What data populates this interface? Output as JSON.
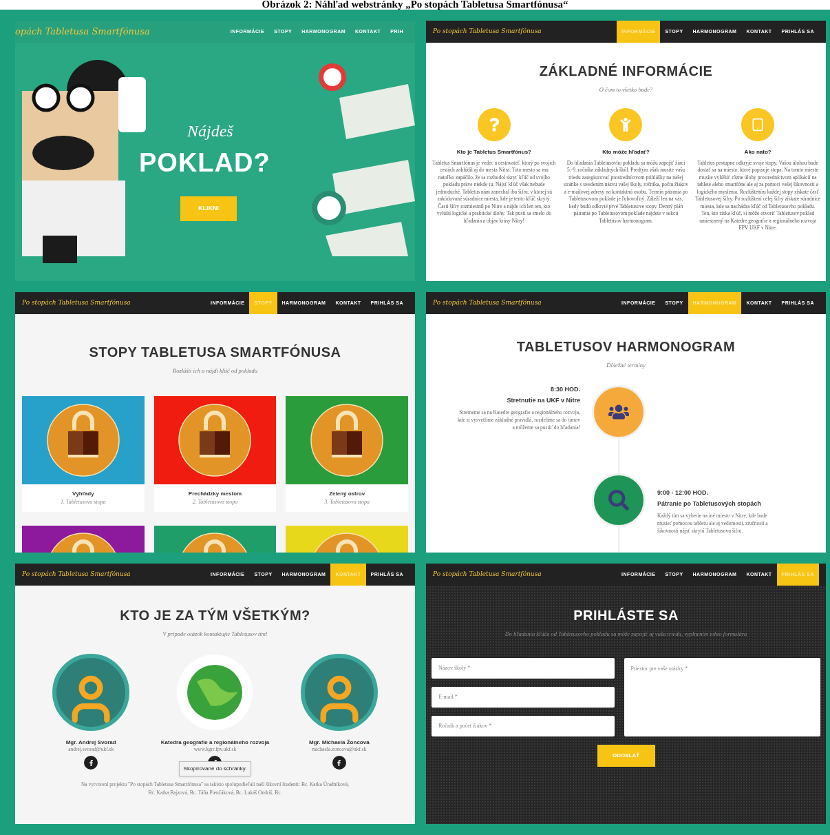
{
  "caption": "Obrázok 2: Náhľad webstránky „Po stopách Tabletusa Smartfónusa“",
  "panels": [
    {
      "kind": "hero",
      "brand": "opách Tabletusa Smartfónusa",
      "nav": [
        {
          "label": "INFORMÁCIE",
          "selected": false
        },
        {
          "label": "STOPY",
          "selected": false
        },
        {
          "label": "HARMONOGRAM",
          "selected": false
        },
        {
          "label": "KONTAKT",
          "selected": false
        },
        {
          "label": "PRIH",
          "selected": false
        }
      ],
      "tagline": "Nájdeš",
      "headline": "POKLAD?",
      "button": "KLIKNI"
    },
    {
      "kind": "info",
      "brand": "Po stopách Tabletusa Smartfónusa",
      "nav": [
        {
          "label": "INFORMÁCIE",
          "selected": true
        },
        {
          "label": "STOPY",
          "selected": false
        },
        {
          "label": "HARMONOGRAM",
          "selected": false
        },
        {
          "label": "KONTAKT",
          "selected": false
        },
        {
          "label": "PRIHLÁS SA",
          "selected": false
        }
      ],
      "title": "ZÁKLADNÉ INFORMÁCIE",
      "subtitle": "O čom to všetko bude?",
      "features": [
        {
          "kind": "question",
          "title": "Kto je Tabletus Smartfónus?",
          "text": "Tabletus Smartfónus je vedec a cestovateľ, ktorý po svojich cestách zablúdil aj do mesta Nitra. Toto mesto sa mu natoľko zapáčilo, že sa rozhodol skryť kľúč od svojho pokladu práve niekde tu. Nájsť kľúč však nebude jednoduché. Tabletus nám zanechal iba šifru, v ktorej sú zakódované súradnice miesta, kde je tento kľúč skrytý. Časti šifry rozmiestnil po Nitre a nájde ich len ten, kto vylúšti logické a praktické úlohy. Tak pusti sa smelo do hľadania a objav krásy Nitry!"
        },
        {
          "kind": "child",
          "title": "Kto môže hľadať?",
          "text": "Do hľadania Tabletusovho pokladu sa môžu zapojiť žiaci 5.-9. ročníka základných škôl. Predtým však musíte vašu triedu zaregistrovať prostredníctvom prihlášky na našej stránke s uvedením názvu vašej školy, ročníka, počtu žiakov a e-mailovej adresy na kontaktnú osobu. Termín pátrania po Tabletusovom poklade je ľubovoľný. Záleží len na vás, kedy budú odkryté prvé Tabletusove stopy. Denný plán pátrania po Tabletusovom poklade nájdete v sekcii Tabletusov harmonogram."
        },
        {
          "kind": "tablet",
          "title": "Ako nato?",
          "text": "Tabletus postupne odkryje svoje stopy. Vašou úlohou bude dostať sa na miesto, ktoré popisuje stopa. Na tomto mieste musíte vylúštiť rôzne úlohy prostredníctvom aplikácií na tablete alebo smartfóne ale aj za pomoci vašej šikovnosti a logického myslenia. Rozlúštením každej stopy získate časť Tabletusovej šifry. Po rozlúštení celej šifry získate súradnice miesta, kde sa nachádza kľúč od Tabletusovho pokladu. Ten, kto získa kľúč, si môže otvoriť Tabletusov poklad umiestnený na Katedre geografie a regionálneho rozvoja FPV UKF v Nitre."
        }
      ]
    },
    {
      "kind": "tracks",
      "brand": "Po stopách Tabletusa Smartfónusa",
      "nav": [
        {
          "label": "INFORMÁCIE",
          "selected": false
        },
        {
          "label": "STOPY",
          "selected": true
        },
        {
          "label": "HARMONOGRAM",
          "selected": false
        },
        {
          "label": "KONTAKT",
          "selected": false
        },
        {
          "label": "PRIHLÁS SA",
          "selected": false
        }
      ],
      "title": "STOPY TABLETUSA SMARTFÓNUSA",
      "subtitle": "Rozlúšti ich a nájdi kľúč od pokladu",
      "cards": [
        {
          "title": "Výhľady",
          "subtitle": "1. Tabletusova stopa",
          "color": "#27a1c9"
        },
        {
          "title": "Prechádzky mestom",
          "subtitle": "2. Tabletusova stopa",
          "color": "#f01c10"
        },
        {
          "title": "Zelený ostrov",
          "subtitle": "3. Tabletusova stopa",
          "color": "#2b9c3b"
        },
        {
          "color": "#8d1a9c"
        },
        {
          "color": "#1f9e6a"
        },
        {
          "color": "#e8d81c"
        }
      ]
    },
    {
      "kind": "schedule",
      "brand": "Po stopách Tabletusa Smartfónusa",
      "nav": [
        {
          "label": "INFORMÁCIE",
          "selected": false
        },
        {
          "label": "STOPY",
          "selected": false
        },
        {
          "label": "HARMONOGRAM",
          "selected": true
        },
        {
          "label": "KONTAKT",
          "selected": false
        },
        {
          "label": "PRIHLÁS SA",
          "selected": false
        }
      ],
      "title": "TABLETUSOV HARMONOGRAM",
      "subtitle": "Dôležité termíny",
      "events": [
        {
          "kind": "group",
          "time": "8:30 HOD.",
          "title": "Stretnutie na UKF v Nitre",
          "text": "Stretneme sa na Katedre geografie a regionálneho rozvoja, kde si vysvetlíme základné pravidlá, rozdelíme sa do tímov a môžeme sa pustiť do hľadania!",
          "color": "#f6a93b"
        },
        {
          "kind": "search",
          "time": "9:00 - 12:00 HOD.",
          "title": "Pátranie po Tabletusových stopách",
          "text": "Každý tím sa vyberie na iné miesto v Nitre, kde bude musieť pomocou tabletu ale aj vedomostí, zručností a šikovnosti nájsť skrytú Tabletusovu šifru.",
          "color": "#1e9456"
        }
      ]
    },
    {
      "kind": "contact",
      "brand": "Po stopách Tabletusa Smartfónusa",
      "nav": [
        {
          "label": "INFORMÁCIE",
          "selected": false
        },
        {
          "label": "STOPY",
          "selected": false
        },
        {
          "label": "HARMONOGRAM",
          "selected": false
        },
        {
          "label": "KONTAKT",
          "selected": true
        },
        {
          "label": "PRIHLÁS SA",
          "selected": false
        }
      ],
      "title": "KTO JE ZA TÝM VŠETKÝM?",
      "subtitle": "V prípade otázok kontaktujte Tabletusov tím!",
      "people": [
        {
          "kind": "man",
          "name": "Mgr. Andrej Svorad",
          "contact": "andrej.svorad@ukf.sk"
        },
        {
          "kind": "globe",
          "name": "Katedra geografie a regionálneho rozvoja",
          "contact": "www.kgrr.fpv.ukf.sk"
        },
        {
          "kind": "woman",
          "name": "Mgr. Michaela Žoncová",
          "contact": "michaela.zoncova@ukf.sk"
        }
      ],
      "toast": "Skopírované do schránky.",
      "note": "Na vytvorení projektu \"Po stopách Tabletusa Smartfónusa\" sa takisto spolupodieľali naši šikovní študenti: Bc. Katka Úradníková, Bc. Katka Bajzová, Bc. Táňa Pienčáková, Bc. Lukáš Ondriš, Bc."
    },
    {
      "kind": "signup",
      "brand": "Po stopách Tabletusa Smartfónusa",
      "nav": [
        {
          "label": "INFORMÁCIE",
          "selected": false
        },
        {
          "label": "STOPY",
          "selected": false
        },
        {
          "label": "HARMONOGRAM",
          "selected": false
        },
        {
          "label": "KONTAKT",
          "selected": false
        },
        {
          "label": "PRIHLÁS SA",
          "selected": true
        }
      ],
      "title": "PRIHLÁSTE SA",
      "subtitle": "Do hľadania kľúča od Tabletusovho pokladu sa môže zapojiť aj vaša trieda, vyplnením tohto formulára",
      "fields": [
        {
          "placeholder": "Názov školy *"
        },
        {
          "placeholder": "E-mail *"
        },
        {
          "placeholder": "Ročník a počet žiakov *"
        }
      ],
      "textarea": {
        "placeholder": "Priestor pre vaše otázky *"
      },
      "button": "ODOSLAŤ"
    }
  ]
}
